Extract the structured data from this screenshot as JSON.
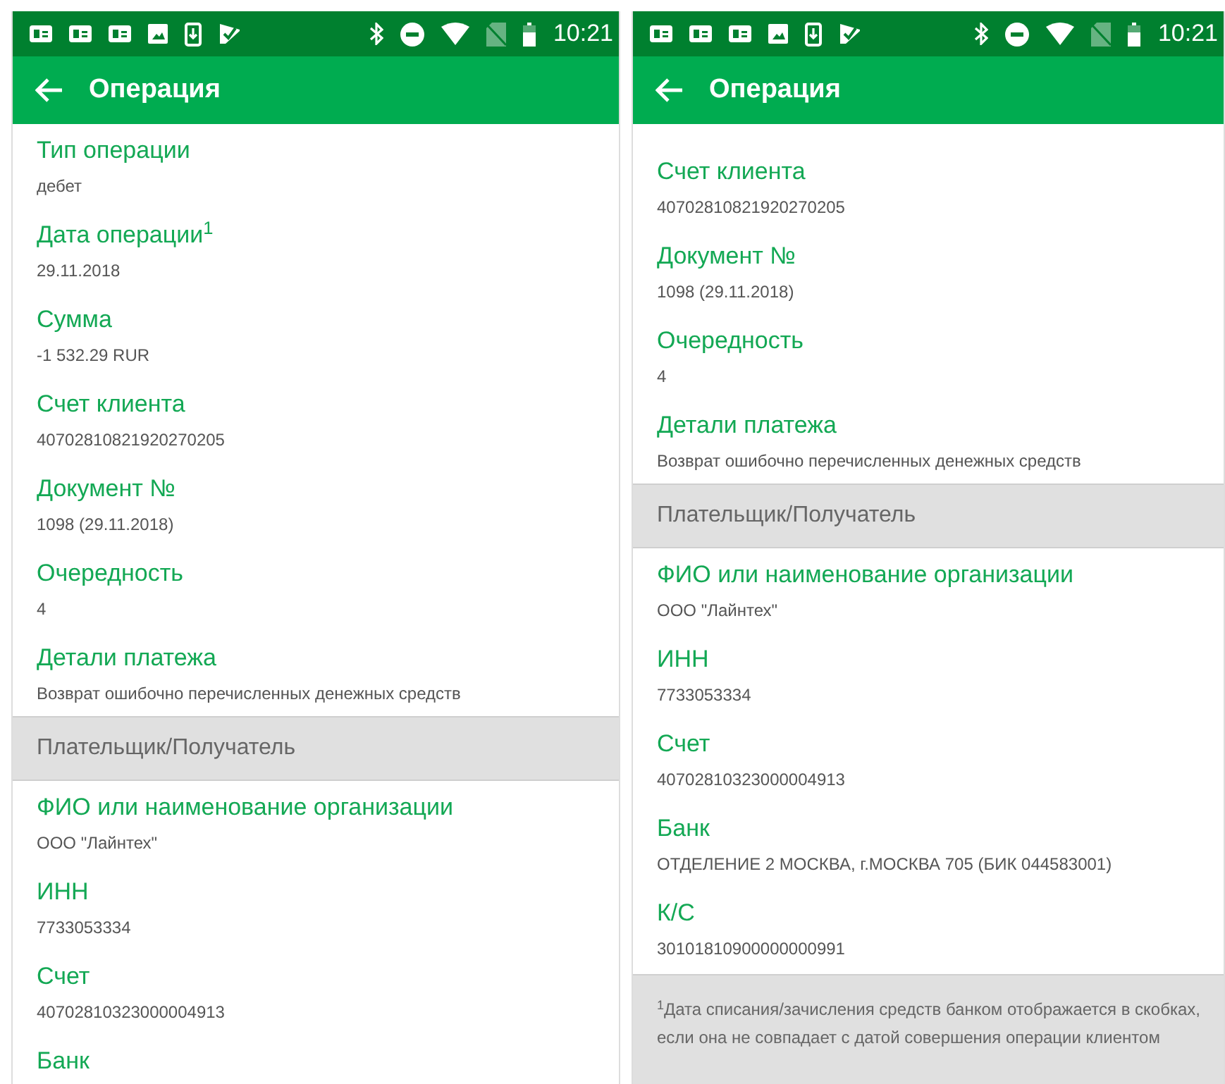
{
  "screens": [
    {
      "status_bar": {
        "time": "10:21"
      },
      "app_bar": {
        "title": "Операция"
      },
      "items": [
        {
          "kind": "field",
          "label": "Тип операции",
          "value": "дебет"
        },
        {
          "kind": "field",
          "label": "Дата операции$^{1}$",
          "value": "29.11.2018"
        },
        {
          "kind": "field",
          "label": "Сумма",
          "value": "-1 532.29 RUR"
        },
        {
          "kind": "field",
          "label": "Счет клиента",
          "value": "40702810821920270205"
        },
        {
          "kind": "field",
          "label": "Документ №",
          "value": "1098 (29.11.2018)"
        },
        {
          "kind": "field",
          "label": "Очередность",
          "value": "4"
        },
        {
          "kind": "field",
          "label": "Детали платежа",
          "value": "Возврат ошибочно перечисленных денежных средств"
        },
        {
          "kind": "section",
          "title": "Плательщик/Получатель"
        },
        {
          "kind": "field",
          "label": "ФИО или наименование организации",
          "value": "ООО \"Лайнтех\""
        },
        {
          "kind": "field",
          "label": "ИНН",
          "value": "7733053334"
        },
        {
          "kind": "field",
          "label": "Счет",
          "value": "40702810323000004913"
        },
        {
          "kind": "field",
          "label": "Банк"
        }
      ]
    },
    {
      "status_bar": {
        "time": "10:21"
      },
      "app_bar": {
        "title": "Операция"
      },
      "items": [
        {
          "kind": "field",
          "label": "Счет клиента",
          "value": "40702810821920270205"
        },
        {
          "kind": "field",
          "label": "Документ №",
          "value": "1098 (29.11.2018)"
        },
        {
          "kind": "field",
          "label": "Очередность",
          "value": "4"
        },
        {
          "kind": "field",
          "label": "Детали платежа",
          "value": "Возврат ошибочно перечисленных денежных средств"
        },
        {
          "kind": "section",
          "title": "Плательщик/Получатель"
        },
        {
          "kind": "field",
          "label": "ФИО или наименование организации",
          "value": "ООО \"Лайнтех\""
        },
        {
          "kind": "field",
          "label": "ИНН",
          "value": "7733053334"
        },
        {
          "kind": "field",
          "label": "Счет",
          "value": "40702810323000004913"
        },
        {
          "kind": "field",
          "label": "Банк",
          "value": "ОТДЕЛЕНИЕ 2 МОСКВА, г.МОСКВА 705 (БИК 044583001)"
        },
        {
          "kind": "field",
          "label": "К/С",
          "value": "30101810900000000991"
        },
        {
          "kind": "note",
          "text": "$^{1}$Дата списания/зачисления средств банком отображается в скобках, если она не совпадает с датой совершения операции клиентом"
        }
      ]
    }
  ]
}
